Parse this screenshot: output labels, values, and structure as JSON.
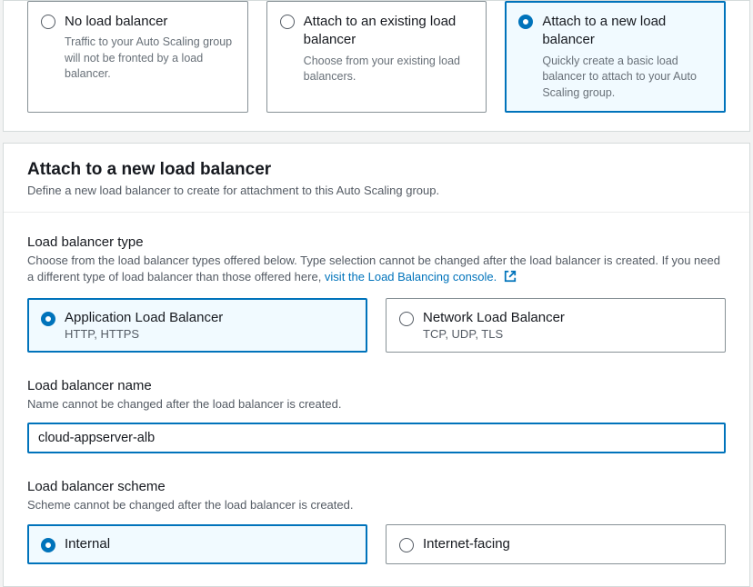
{
  "topOptions": [
    {
      "title": "No load balancer",
      "desc": "Traffic to your Auto Scaling group will not be fronted by a load balancer."
    },
    {
      "title": "Attach to an existing load balancer",
      "desc": "Choose from your existing load balancers."
    },
    {
      "title": "Attach to a new load balancer",
      "desc": "Quickly create a basic load balancer to attach to your Auto Scaling group."
    }
  ],
  "section": {
    "heading": "Attach to a new load balancer",
    "sub": "Define a new load balancer to create for attachment to this Auto Scaling group."
  },
  "lbType": {
    "label": "Load balancer type",
    "descPrefix": "Choose from the load balancer types offered below. Type selection cannot be changed after the load balancer is created. If you need a different type of load balancer than those offered here, ",
    "linkText": "visit the Load Balancing console.",
    "options": [
      {
        "title": "Application Load Balancer",
        "sub": "HTTP, HTTPS"
      },
      {
        "title": "Network Load Balancer",
        "sub": "TCP, UDP, TLS"
      }
    ]
  },
  "lbName": {
    "label": "Load balancer name",
    "desc": "Name cannot be changed after the load balancer is created.",
    "value": "cloud-appserver-alb"
  },
  "lbScheme": {
    "label": "Load balancer scheme",
    "desc": "Scheme cannot be changed after the load balancer is created.",
    "options": [
      {
        "title": "Internal"
      },
      {
        "title": "Internet-facing"
      }
    ]
  }
}
